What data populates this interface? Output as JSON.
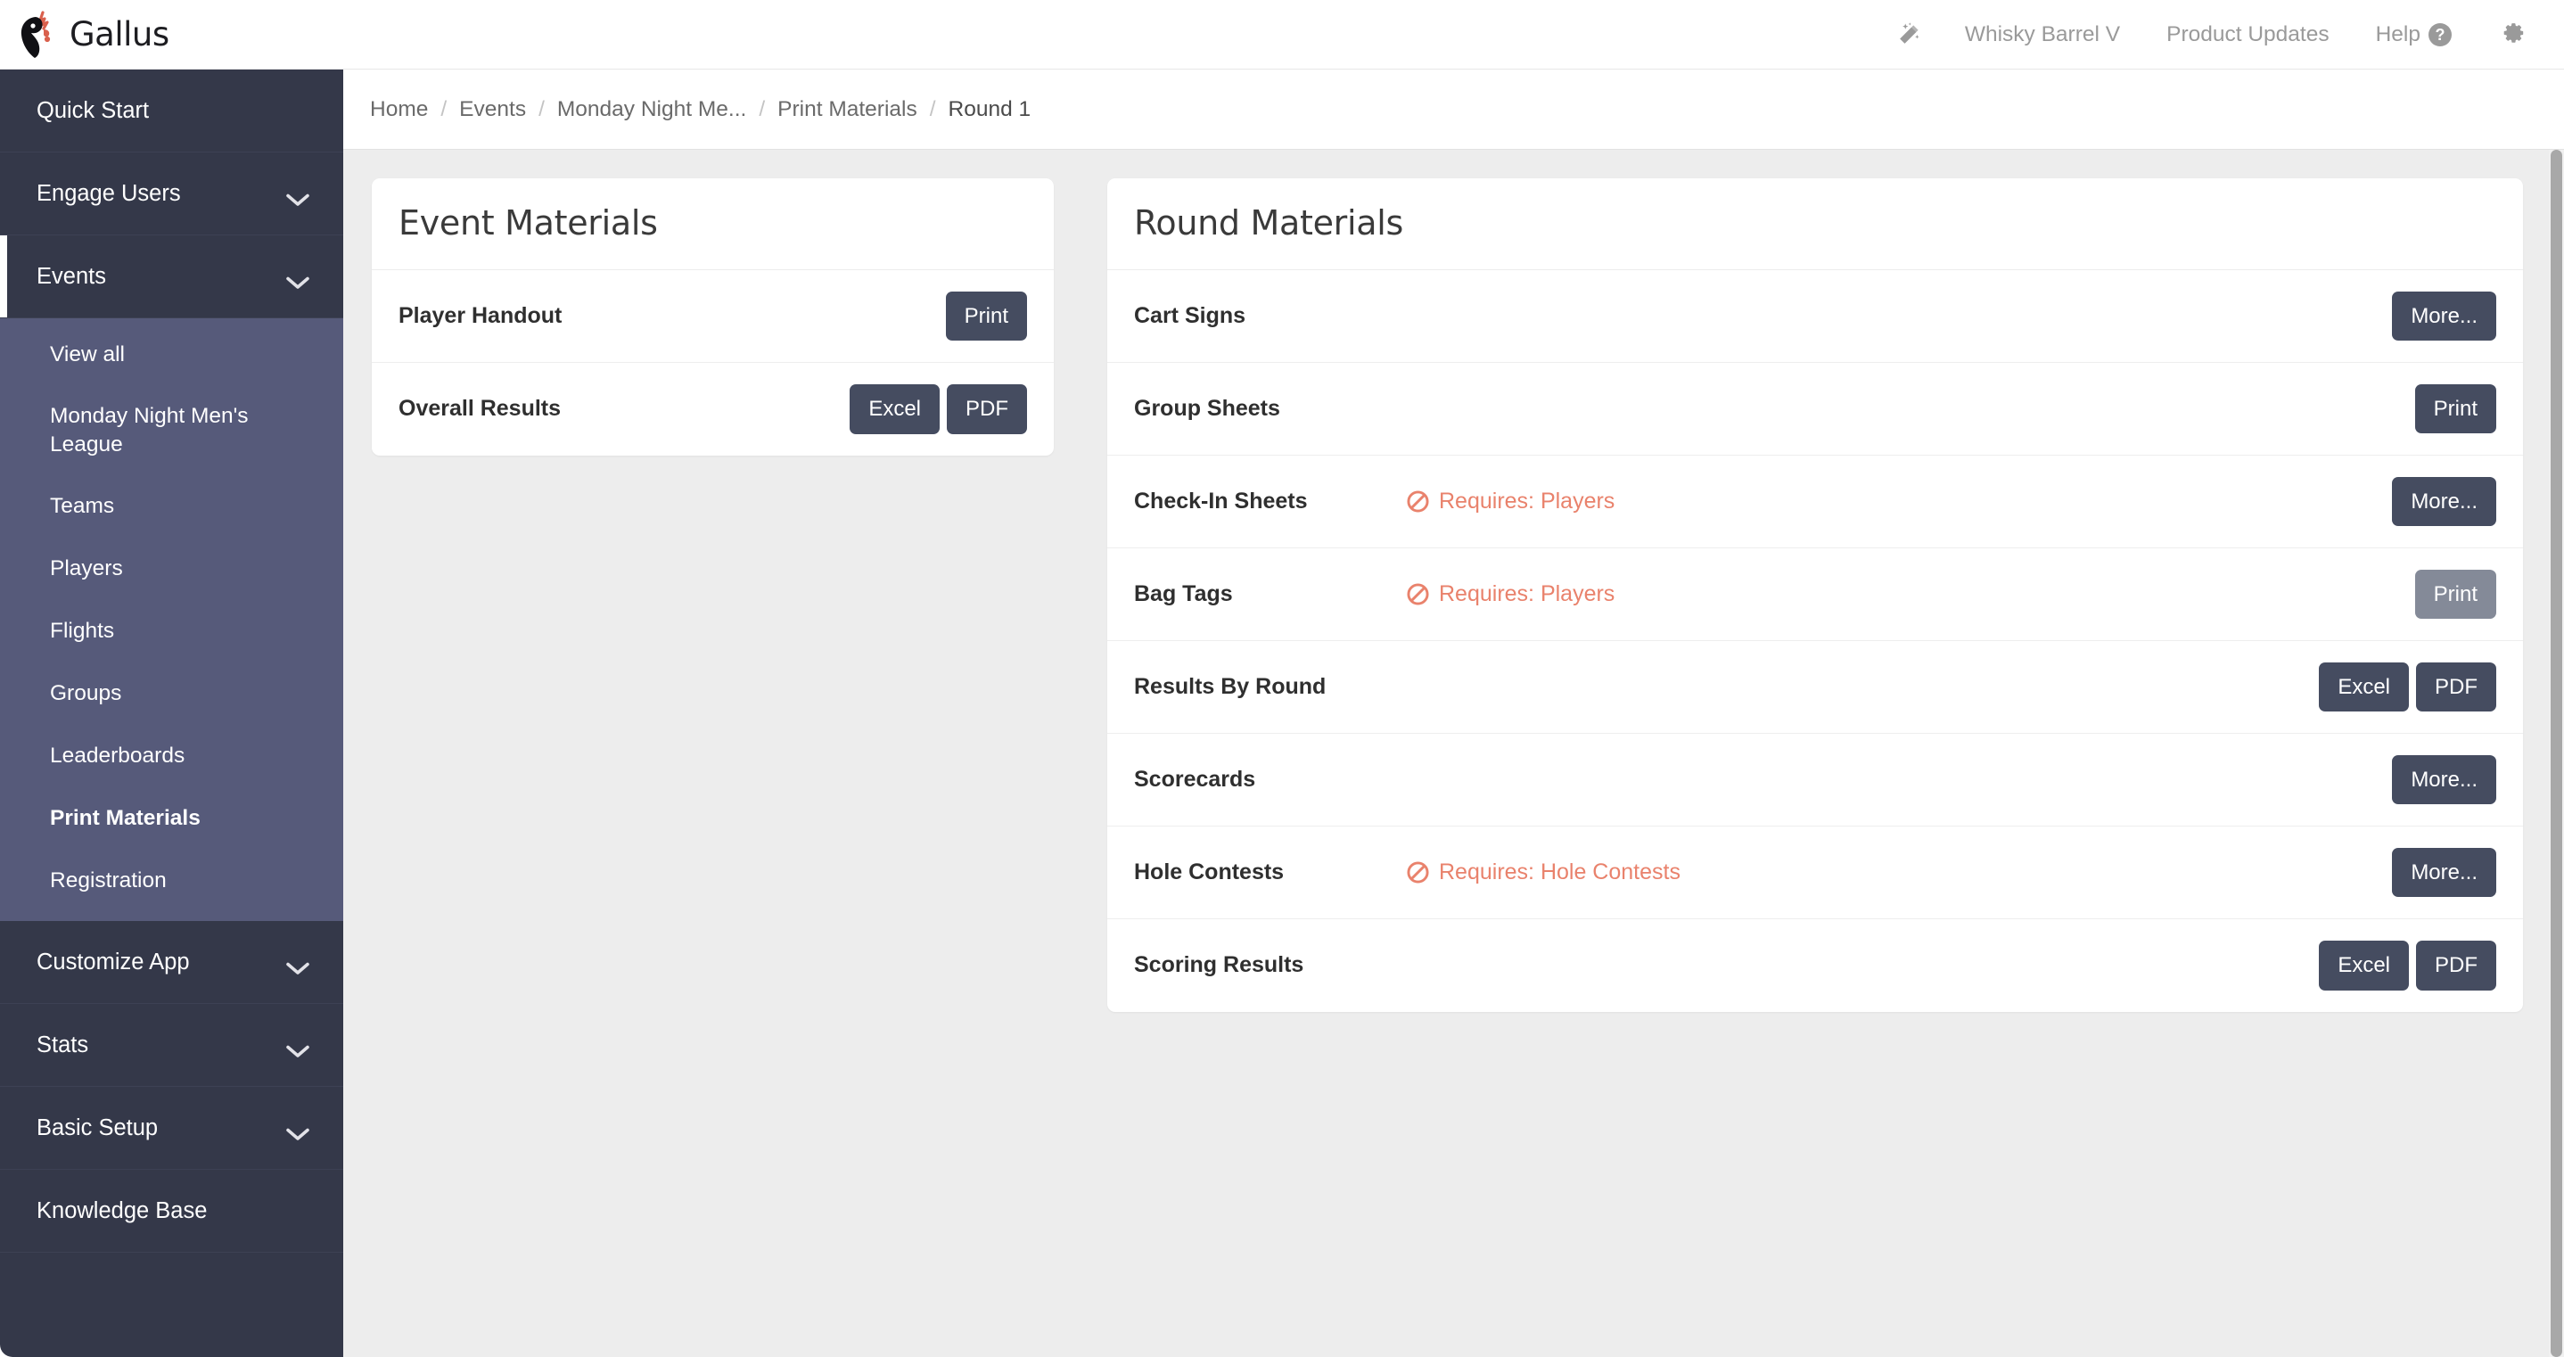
{
  "brand": {
    "name": "Gallus",
    "logo_icon": "rooster-icon"
  },
  "topnav": {
    "wand_icon": "magic-wand-icon",
    "items": [
      {
        "label": "Whisky Barrel V",
        "icon": null
      },
      {
        "label": "Product Updates",
        "icon": null
      },
      {
        "label": "Help",
        "icon": "help-question-icon"
      }
    ],
    "gear_icon": "gear-icon"
  },
  "sidebar": {
    "items": [
      {
        "label": "Quick Start",
        "expandable": false,
        "active": false
      },
      {
        "label": "Engage Users",
        "expandable": true,
        "active": false
      },
      {
        "label": "Events",
        "expandable": true,
        "active": true
      }
    ],
    "submenu": [
      {
        "label": "View all",
        "active": false
      },
      {
        "label": "Monday Night Men's League",
        "active": false
      },
      {
        "label": "Teams",
        "active": false
      },
      {
        "label": "Players",
        "active": false
      },
      {
        "label": "Flights",
        "active": false
      },
      {
        "label": "Groups",
        "active": false
      },
      {
        "label": "Leaderboards",
        "active": false
      },
      {
        "label": "Print Materials",
        "active": true
      },
      {
        "label": "Registration",
        "active": false
      }
    ],
    "items_bottom": [
      {
        "label": "Customize App",
        "expandable": true
      },
      {
        "label": "Stats",
        "expandable": true
      },
      {
        "label": "Basic Setup",
        "expandable": true
      },
      {
        "label": "Knowledge Base",
        "expandable": false
      }
    ]
  },
  "breadcrumb": {
    "separator": "/",
    "items": [
      {
        "label": "Home"
      },
      {
        "label": "Events"
      },
      {
        "label": "Monday Night Me..."
      },
      {
        "label": "Print Materials"
      },
      {
        "label": "Round 1"
      }
    ]
  },
  "event_materials": {
    "title": "Event Materials",
    "rows": [
      {
        "label": "Player Handout",
        "requires": null,
        "buttons": [
          {
            "label": "Print",
            "disabled": false
          }
        ]
      },
      {
        "label": "Overall Results",
        "requires": null,
        "buttons": [
          {
            "label": "Excel",
            "disabled": false
          },
          {
            "label": "PDF",
            "disabled": false
          }
        ]
      }
    ]
  },
  "round_materials": {
    "title": "Round Materials",
    "requires_icon": "prohibition-icon",
    "rows": [
      {
        "label": "Cart Signs",
        "requires": null,
        "buttons": [
          {
            "label": "More...",
            "disabled": false
          }
        ]
      },
      {
        "label": "Group Sheets",
        "requires": null,
        "buttons": [
          {
            "label": "Print",
            "disabled": false
          }
        ]
      },
      {
        "label": "Check-In Sheets",
        "requires": "Requires: Players",
        "buttons": [
          {
            "label": "More...",
            "disabled": false
          }
        ]
      },
      {
        "label": "Bag Tags",
        "requires": "Requires: Players",
        "buttons": [
          {
            "label": "Print",
            "disabled": true
          }
        ]
      },
      {
        "label": "Results By Round",
        "requires": null,
        "buttons": [
          {
            "label": "Excel",
            "disabled": false
          },
          {
            "label": "PDF",
            "disabled": false
          }
        ]
      },
      {
        "label": "Scorecards",
        "requires": null,
        "buttons": [
          {
            "label": "More...",
            "disabled": false
          }
        ]
      },
      {
        "label": "Hole Contests",
        "requires": "Requires: Hole Contests",
        "buttons": [
          {
            "label": "More...",
            "disabled": false
          }
        ]
      },
      {
        "label": "Scoring Results",
        "requires": null,
        "buttons": [
          {
            "label": "Excel",
            "disabled": false
          },
          {
            "label": "PDF",
            "disabled": false
          }
        ]
      }
    ]
  },
  "colors": {
    "sidebar_bg": "#343849",
    "submenu_bg": "#565a7a",
    "button_bg": "#454c60",
    "button_disabled_bg": "#848a98",
    "warning": "#e9826c",
    "content_bg": "#ededed",
    "logo_accent": "#d9604d"
  }
}
